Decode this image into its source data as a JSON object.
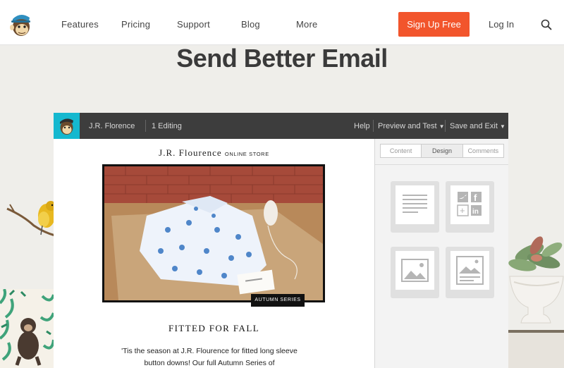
{
  "nav": {
    "items": [
      "Features",
      "Pricing",
      "Support",
      "Blog",
      "More"
    ],
    "signup_label": "Sign Up Free",
    "login_label": "Log In"
  },
  "hero": {
    "title": "Send Better Email"
  },
  "editor": {
    "account": "J.R. Florence",
    "editing": "1 Editing",
    "menu": [
      "Help",
      "Preview and Test",
      "Save and Exit"
    ],
    "tabs": [
      "Content",
      "Design",
      "Comments"
    ],
    "active_tab": "Design",
    "email": {
      "store_name": "J.R. Flourence",
      "store_suffix": "ONLINE STORE",
      "badge": "AUTUMN SERIES",
      "headline": "FITTED FOR FALL",
      "body": "'Tis the season at J.R. Flourence for fitted long sleeve button downs! Our full Autumn Series of"
    },
    "blocks": [
      "text-block-icon",
      "social-block-icon",
      "image-block-icon",
      "image-card-block-icon"
    ]
  },
  "colors": {
    "accent": "#f2552c",
    "editor_bar": "#3d3d3d",
    "editor_logo_bg": "#15b8cf"
  }
}
